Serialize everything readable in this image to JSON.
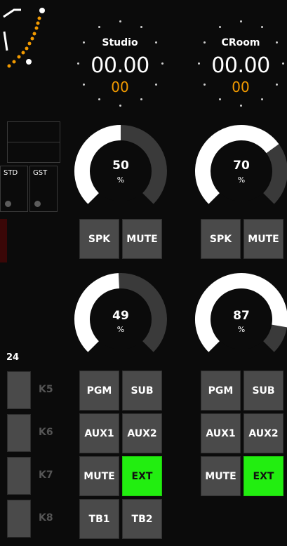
{
  "left_panel": {
    "tags": [
      "STD",
      "GST"
    ],
    "section_label": "24",
    "k_labels": [
      "K5",
      "K6",
      "K7",
      "K8"
    ]
  },
  "clocks": [
    {
      "title": "Studio",
      "time": "00.00",
      "frames": "00"
    },
    {
      "title": "CRoom",
      "time": "00.00",
      "frames": "00"
    }
  ],
  "gauges": [
    {
      "value": "50",
      "unit": "%"
    },
    {
      "value": "70",
      "unit": "%"
    },
    {
      "value": "49",
      "unit": "%"
    },
    {
      "value": "87",
      "unit": "%"
    }
  ],
  "speaker_buttons": {
    "spk": "SPK",
    "mute": "MUTE"
  },
  "routing_buttons": {
    "pgm": "PGM",
    "sub": "SUB",
    "aux1": "AUX1",
    "aux2": "AUX2",
    "mute": "MUTE",
    "ext": "EXT",
    "tb1": "TB1",
    "tb2": "TB2"
  },
  "colors": {
    "active": "#22ee10",
    "accent": "#f29a00"
  }
}
